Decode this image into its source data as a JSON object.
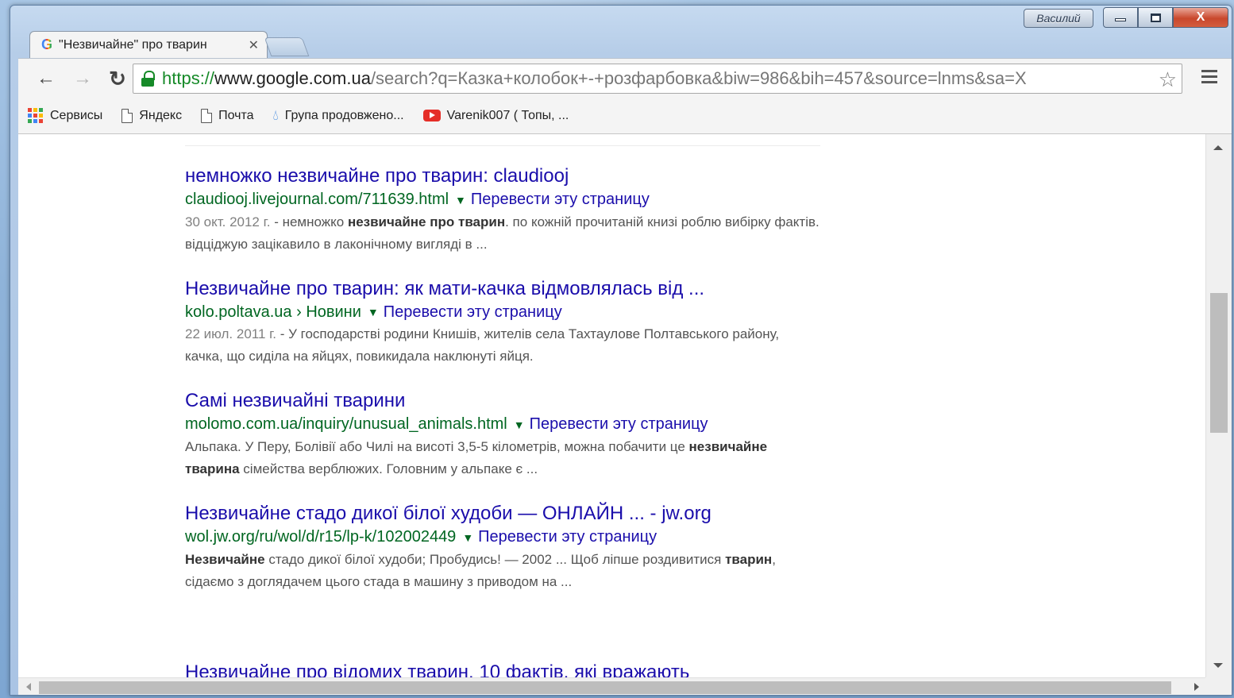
{
  "window": {
    "user_name": "Василий",
    "minimize_icon": "minimize-icon",
    "maximize_icon": "maximize-icon",
    "close_label": "X"
  },
  "tab": {
    "title": "\"Незвичайне\" про тварин",
    "close_label": "✕",
    "favicon": "G"
  },
  "toolbar": {
    "back": "←",
    "forward": "→",
    "reload": "↻",
    "url_scheme": "https://",
    "url_host": "www.google.com.ua",
    "url_path": "/search?q=Казка+колобок+-+розфарбовка&biw=986&bih=457&source=lnms&sa=X",
    "star": "☆"
  },
  "bookmarks": [
    {
      "label": "Сервисы",
      "icon": "apps-grid-icon"
    },
    {
      "label": "Яндекс",
      "icon": "page-icon"
    },
    {
      "label": "Почта",
      "icon": "page-icon"
    },
    {
      "label": "Група продовжено...",
      "icon": "drop-icon"
    },
    {
      "label": "Varenik007 ( Топы, ...",
      "icon": "youtube-icon"
    }
  ],
  "results": [
    {
      "title": "немножко незвичайне про тварин: claudiooj",
      "url": "claudiooj.livejournal.com/711639.html",
      "translate": "Перевести эту страницу",
      "snippet_date": "30 окт. 2012 г.",
      "snippet_a": " - немножко ",
      "snippet_b1": "незвичайне про тварин",
      "snippet_c": ". по кожній прочитаній книзі роблю вибірку фактів. відціджую зацікавило в лаконічному вигляді в ..."
    },
    {
      "title": "Незвичайне про тварин: як мати-качка відмовлялась від ...",
      "url": "kolo.poltava.ua › Новини",
      "translate": "Перевести эту страницу",
      "snippet_date": "22 июл. 2011 г.",
      "snippet_a": " - У господарстві родини Книшів, жителів села Тахтаулове Полтавського району, качка, що сиділа на яйцях, повикидала наклюнуті яйця.",
      "snippet_b1": "",
      "snippet_c": ""
    },
    {
      "title": "Самі незвичайні тварини",
      "url": "molomo.com.ua/inquiry/unusual_animals.html",
      "translate": "Перевести эту страницу",
      "snippet_date": "",
      "snippet_a": "Альпака. У Перу, Болівії або Чилі на висоті 3,5-5 кілометрів, можна побачити це ",
      "snippet_b1": "незвичайне тварина",
      "snippet_c": " сімейства верблюжих. Головним у альпаке є ..."
    },
    {
      "title": "Незвичайне стадо дикої білої худоби — ОНЛАЙН ... - jw.org",
      "url": "wol.jw.org/ru/wol/d/r15/lp-k/102002449",
      "translate": "Перевести эту страницу",
      "snippet_date": "",
      "snippet_a": "",
      "snippet_b1": "Незвичайне",
      "snippet_c": " стадо дикої білої худоби; Пробудись! — 2002 ... Щоб ліпше роздивитися ",
      "snippet_b2": "тварин",
      "snippet_d": ", сідаємо з доглядачем цього стада в машину з приводом на ..."
    }
  ],
  "cut_title": "Незвичайне про відомих тварин. 10 фактів, які вражають"
}
